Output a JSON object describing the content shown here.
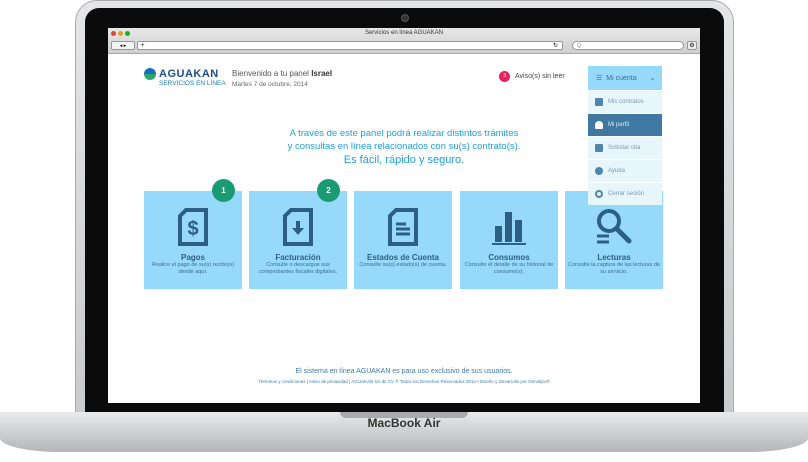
{
  "device": {
    "brand": "MacBook Air"
  },
  "browser": {
    "title": "Servicios en línea AGUAKAN",
    "url": "",
    "search_placeholder": "Q"
  },
  "header": {
    "logo_name": "AGUAKAN",
    "logo_sub": "SERVICIOS EN LÍNEA",
    "welcome": "Bienvenido a tu panel",
    "user": "Israel",
    "date": "Martes 7 de octubre, 2014",
    "notif_count": "3",
    "notif_label": "Aviso(s) sin leer"
  },
  "menu": {
    "label": "Mi cuenta",
    "items": [
      {
        "label": "Mis contratos",
        "icon": "contract-icon"
      },
      {
        "label": "Mi perfil",
        "icon": "user-icon",
        "active": true
      },
      {
        "label": "Solicitar cita",
        "icon": "calendar-icon"
      },
      {
        "label": "Ayuda",
        "icon": "lifebuoy-icon"
      },
      {
        "label": "Cerrar sesión",
        "icon": "power-icon"
      }
    ]
  },
  "intro": {
    "line1": "A través de este panel podrá realizar distintos trámites",
    "line2": "y consultas en línea relacionados con su(s) contrato(s).",
    "line3": "Es fácil, rápido y seguro."
  },
  "tiles": [
    {
      "title": "Pagos",
      "desc": "Realice el pago de su(s) recibo(s) desde aquí.",
      "badge": "1"
    },
    {
      "title": "Facturación",
      "desc": "Consulte o descargue sus comprobantes fiscales digitales.",
      "badge": "2"
    },
    {
      "title": "Estados de Cuenta",
      "desc": "Consulte su(s) estado(s) de cuenta."
    },
    {
      "title": "Consumos",
      "desc": "Consulte el detalle de su historial de consumo(s)."
    },
    {
      "title": "Lecturas",
      "desc": "Consulte la captura de las lecturas de su servicio."
    }
  ],
  "footer": {
    "notice": "El sistema en línea  AGUAKAN es para uso exclusivo de sus usuarios.",
    "links": "Términos y condiciones  |  Aviso de privacidad  |  AGUAKAN SA de CV ® Todos los Derechos Reservados 2014 • Diseño y Desarrollo por Genotipo®"
  },
  "colors": {
    "tile": "#97d9fb",
    "accent": "#1ea0dc",
    "badge": "#1a9b72",
    "notif": "#ee1d5c",
    "menu_active": "#3f78a0"
  }
}
